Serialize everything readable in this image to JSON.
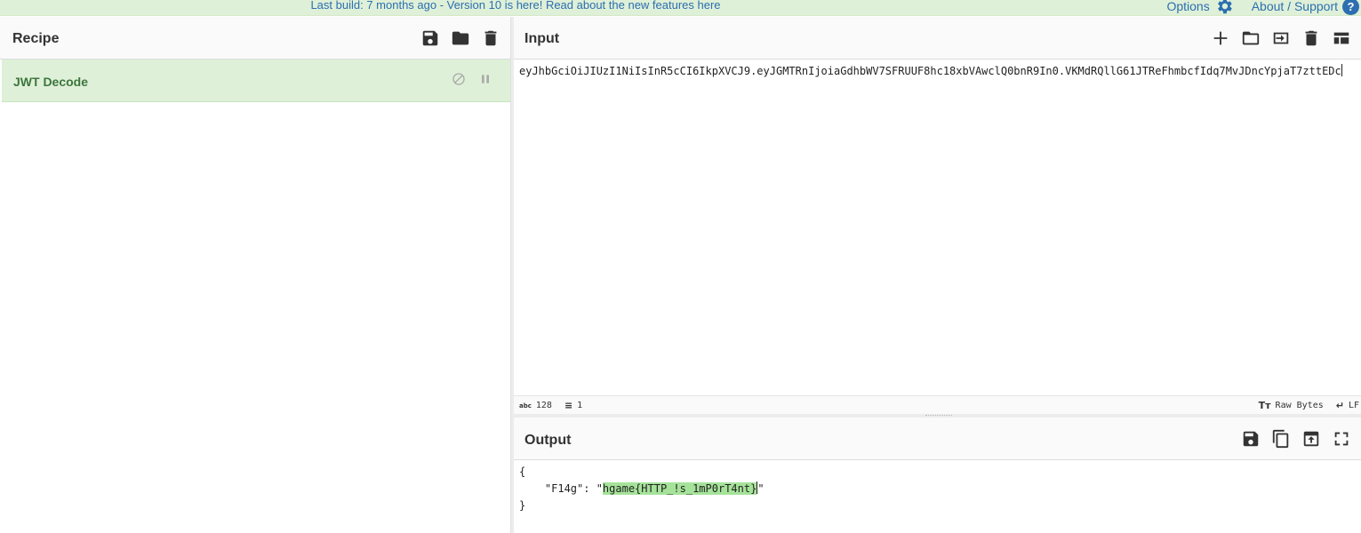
{
  "banner": {
    "message_prefix": "Last build: 7 months ago - Version 10 is here! Read about the new features ",
    "message_link": "here",
    "options_label": "Options",
    "about_label": "About / Support"
  },
  "recipe": {
    "title": "Recipe",
    "operations": [
      {
        "name": "JWT Decode"
      }
    ]
  },
  "input": {
    "title": "Input",
    "value": "eyJhbGciOiJIUzI1NiIsInR5cCI6IkpXVCJ9.eyJGMTRnIjoiaGdhbWV7SFRUUF8hc18xbVAwclQ0bnR9In0.VKMdRQllG61JTReFhmbcfIdq7MvJDncYpjaT7zttEDc"
  },
  "status": {
    "char_count": "128",
    "line_count": "1",
    "encoding": "Raw Bytes",
    "eol": "LF"
  },
  "output": {
    "title": "Output",
    "line1": "{",
    "line2_prefix": "    \"F14g\": \"",
    "highlighted": "hgame{HTTP_!s_1mP0rT4nt}",
    "line2_suffix": "\"",
    "line3": "}"
  },
  "colors": {
    "banner_bg": "#dff0d8",
    "link": "#2c6fb0",
    "operation_bg": "#dff0d8",
    "operation_text": "#3c763d",
    "highlight": "#a6e39a"
  },
  "icons": {
    "recipe_header": [
      "save-icon",
      "folder-icon",
      "trash-icon"
    ],
    "input_header": [
      "plus-icon",
      "folder-icon",
      "import-icon",
      "trash-icon",
      "layout-icon"
    ],
    "output_header": [
      "save-icon",
      "copy-icon",
      "export-icon",
      "fullscreen-icon"
    ],
    "operation": [
      "disable-icon",
      "pause-icon"
    ]
  }
}
